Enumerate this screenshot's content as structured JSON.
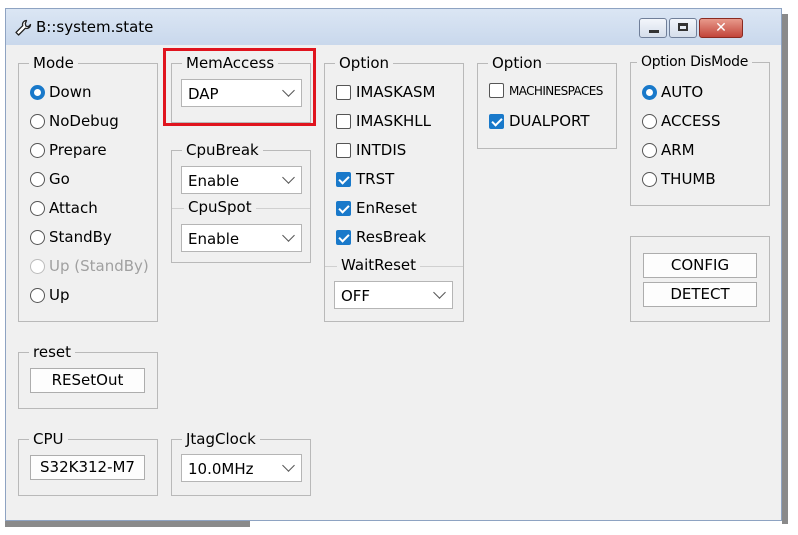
{
  "window": {
    "title": "B::system.state",
    "icon": "wrench-icon",
    "close_glyph": "✕"
  },
  "mode": {
    "legend": "Mode",
    "items": [
      {
        "label": "Down",
        "selected": true,
        "disabled": false
      },
      {
        "label": "NoDebug",
        "selected": false,
        "disabled": false
      },
      {
        "label": "Prepare",
        "selected": false,
        "disabled": false
      },
      {
        "label": "Go",
        "selected": false,
        "disabled": false
      },
      {
        "label": "Attach",
        "selected": false,
        "disabled": false
      },
      {
        "label": "StandBy",
        "selected": false,
        "disabled": false
      },
      {
        "label": "Up (StandBy)",
        "selected": false,
        "disabled": true
      },
      {
        "label": "Up",
        "selected": false,
        "disabled": false
      }
    ]
  },
  "memaccess": {
    "legend": "MemAccess",
    "value": "DAP"
  },
  "cpubreak": {
    "legend": "CpuBreak",
    "value": "Enable"
  },
  "cpuspot": {
    "legend": "CpuSpot",
    "value": "Enable"
  },
  "option1": {
    "legend": "Option",
    "items": [
      {
        "label": "IMASKASM",
        "checked": false
      },
      {
        "label": "IMASKHLL",
        "checked": false
      },
      {
        "label": "INTDIS",
        "checked": false
      },
      {
        "label": "TRST",
        "checked": true
      },
      {
        "label": "EnReset",
        "checked": true
      },
      {
        "label": "ResBreak",
        "checked": true
      }
    ]
  },
  "waitreset": {
    "legend": "WaitReset",
    "value": "OFF"
  },
  "option2": {
    "legend": "Option",
    "items": [
      {
        "label": "MACHINESPACES",
        "checked": false
      },
      {
        "label": "DUALPORT",
        "checked": true
      }
    ]
  },
  "dismode": {
    "legend": "Option DisMode",
    "items": [
      {
        "label": "AUTO",
        "selected": true
      },
      {
        "label": "ACCESS",
        "selected": false
      },
      {
        "label": "ARM",
        "selected": false
      },
      {
        "label": "THUMB",
        "selected": false
      }
    ]
  },
  "actions": {
    "config": "CONFIG",
    "detect": "DETECT"
  },
  "reset": {
    "legend": "reset",
    "button": "RESetOut"
  },
  "cpu": {
    "legend": "CPU",
    "value": "S32K312-M7"
  },
  "jtag": {
    "legend": "JtagClock",
    "value": "10.0MHz"
  },
  "colors": {
    "accent": "#1979ca",
    "highlight": "#e0141e"
  }
}
